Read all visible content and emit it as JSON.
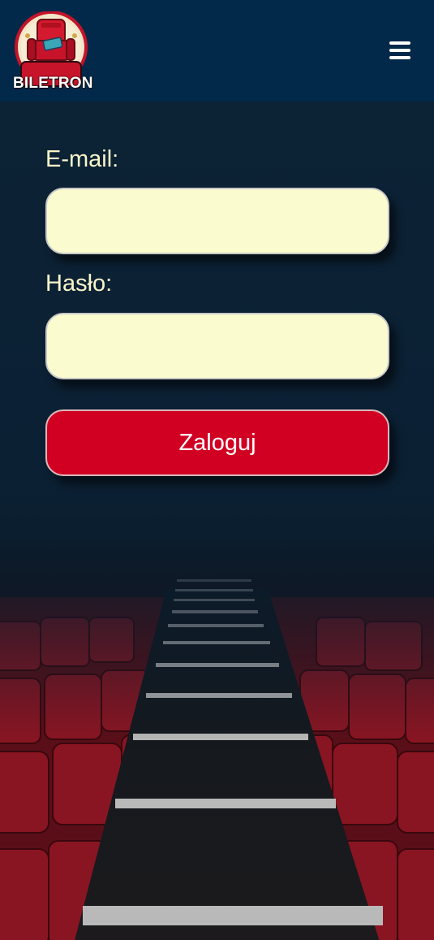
{
  "header": {
    "logo_text": "BILETRON",
    "menu_icon": "hamburger-menu-icon"
  },
  "login_form": {
    "email_label": "E-mail:",
    "email_value": "",
    "password_label": "Hasło:",
    "password_value": "",
    "submit_label": "Zaloguj"
  },
  "colors": {
    "header_bg": "#03294a",
    "page_bg": "#0b2236",
    "label_text": "#f8f5c9",
    "input_bg": "#fafccf",
    "button_bg": "#d10023",
    "seat_red": "#8a1522"
  },
  "background_image": "cinema-seats-and-aisle-stairs"
}
